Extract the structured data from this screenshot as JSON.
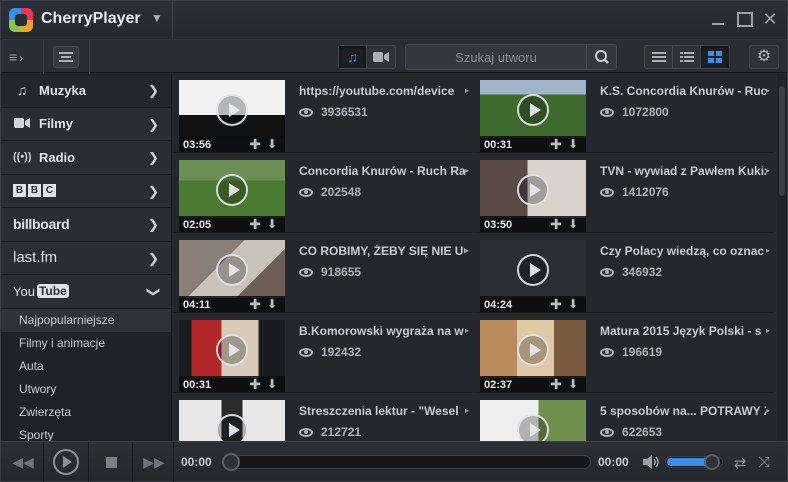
{
  "app": {
    "title": "CherryPlayer"
  },
  "toolbar": {
    "search_placeholder": "Szukaj utworu"
  },
  "sidebar": {
    "items": [
      {
        "label": "Muzyka",
        "icon": "music-note-icon",
        "active": true
      },
      {
        "label": "Filmy",
        "icon": "video-camera-icon"
      },
      {
        "label": "Radio",
        "icon": "radio-waves-icon"
      },
      {
        "label": "BBC",
        "icon": "bbc-logo"
      },
      {
        "label": "billboard",
        "icon": "billboard-logo"
      },
      {
        "label": "last.fm",
        "icon": "lastfm-logo"
      },
      {
        "label": "YouTube",
        "icon": "youtube-logo",
        "expanded": true
      }
    ],
    "youtube_categories": [
      {
        "label": "Najpopularniejsze",
        "selected": true
      },
      {
        "label": "Filmy i animacje"
      },
      {
        "label": "Auta"
      },
      {
        "label": "Utwory"
      },
      {
        "label": "Zwierzęta"
      },
      {
        "label": "Sporty"
      }
    ]
  },
  "videos": [
    {
      "title": "https://youtube.com/device",
      "views": "3936531",
      "duration": "03:56"
    },
    {
      "title": "K.S. Concordia Knurów - Ruch",
      "views": "1072800",
      "duration": "00:31"
    },
    {
      "title": "Concordia Knurów - Ruch Ra",
      "views": "202548",
      "duration": "02:05"
    },
    {
      "title": "TVN - wywiad z Pawłem Kukiz",
      "views": "1412076",
      "duration": "03:50"
    },
    {
      "title": "CO ROBIMY, ŻEBY SIĘ NIE UCZ",
      "views": "918655",
      "duration": "04:11"
    },
    {
      "title": "Czy Polacy wiedzą, co oznac",
      "views": "346932",
      "duration": "04:24"
    },
    {
      "title": "B.Komorowski wygraża na w",
      "views": "192432",
      "duration": "00:31"
    },
    {
      "title": "Matura 2015 Język Polski - s",
      "views": "196619",
      "duration": "02:37"
    },
    {
      "title": "Streszczenia lektur - \"Wesel",
      "views": "212721",
      "duration": ""
    },
    {
      "title": "5 sposobów na... POTRAWY Z",
      "views": "622653",
      "duration": ""
    }
  ],
  "player": {
    "time_current": "00:00",
    "time_total": "00:00",
    "progress": 0,
    "volume": 0.82
  },
  "colors": {
    "accent": "#3a8ee6",
    "background": "#23262b"
  }
}
